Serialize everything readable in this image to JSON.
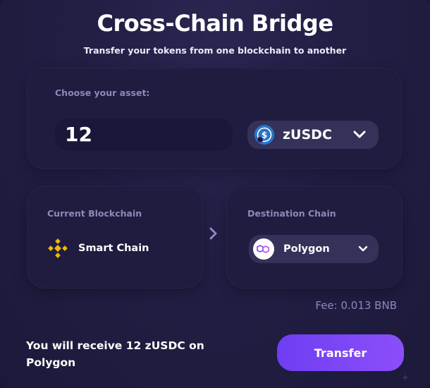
{
  "header": {
    "title": "Cross-Chain Bridge",
    "subtitle": "Transfer your tokens from one blockchain to another"
  },
  "asset": {
    "label": "Choose your asset:",
    "amount": "12",
    "token": "zUSDC",
    "token_icon": "usdc-icon"
  },
  "current_chain": {
    "label": "Current Blockchain",
    "name": "Smart Chain",
    "icon": "bnb-icon"
  },
  "destination_chain": {
    "label": "Destination Chain",
    "name": "Polygon",
    "icon": "polygon-icon"
  },
  "fee": "Fee: 0.013 BNB",
  "summary": "You will receive 12 zUSDC on Polygon",
  "actions": {
    "transfer_label": "Transfer"
  },
  "colors": {
    "background": "#1f1c40",
    "accent": "#7c45f5",
    "muted_text": "#8d89b8"
  }
}
